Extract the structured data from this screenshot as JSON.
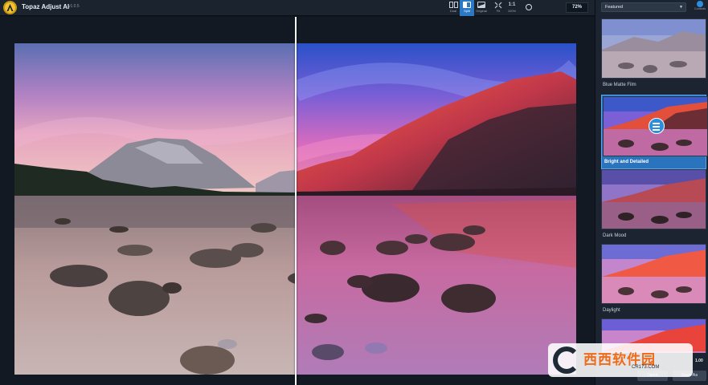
{
  "app": {
    "title": "Topaz Adjust AI",
    "version": "v1.0.5"
  },
  "toolbar": {
    "views": [
      {
        "label": "Dual",
        "active": false
      },
      {
        "label": "Split",
        "active": true
      },
      {
        "label": "Original",
        "active": false
      },
      {
        "label": "Fit",
        "active": false
      },
      {
        "label": "100%",
        "active": false
      }
    ],
    "zoom_value": "72%"
  },
  "panel": {
    "category_select": "Featured",
    "controls_label": "Controls",
    "presets": [
      {
        "name": "Blue Matte Film",
        "selected": false
      },
      {
        "name": "Bright and Detailed",
        "selected": true
      },
      {
        "name": "Dark Mood",
        "selected": false
      },
      {
        "name": "Daylight",
        "selected": false
      },
      {
        "name": "",
        "selected": false
      }
    ],
    "strength_value": "1.00",
    "open_label": "Open",
    "save_label": "Save As"
  },
  "watermark": {
    "text": "西西软件园",
    "url": "CR173.COM"
  },
  "colors": {
    "accent": "#2b79c5",
    "panel_bg": "#1b2430",
    "canvas_bg": "#121922"
  }
}
